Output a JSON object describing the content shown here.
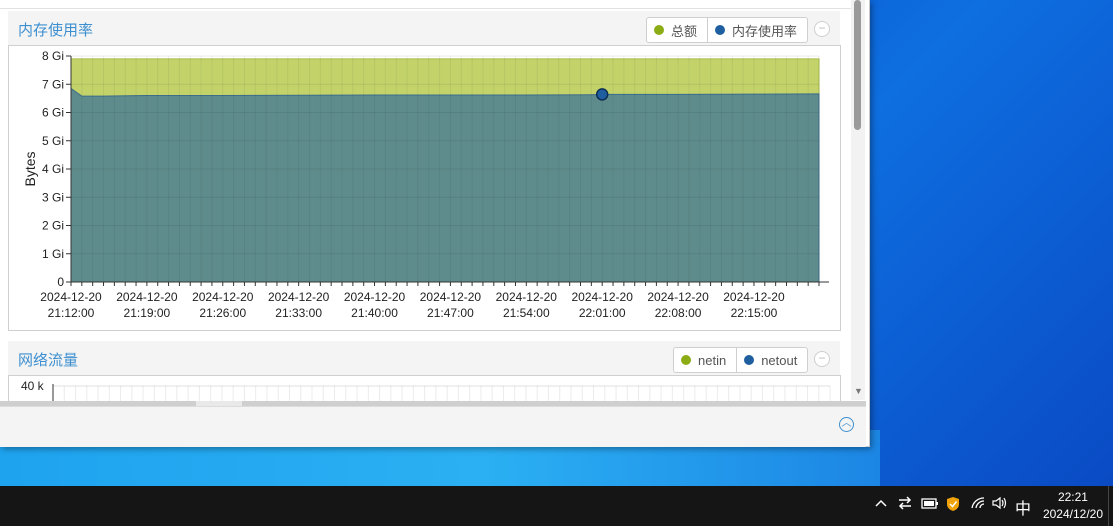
{
  "memory_panel": {
    "title": "内存使用率",
    "legend": [
      {
        "label": "总额",
        "color": "#9bb51e"
      },
      {
        "label": "内存使用率",
        "color": "#1f5fa0"
      }
    ],
    "collapse_symbol": "−"
  },
  "network_panel": {
    "title": "网络流量",
    "legend": [
      {
        "label": "netin",
        "color": "#8cac15"
      },
      {
        "label": "netout",
        "color": "#1f5fa0"
      }
    ],
    "collapse_symbol": "−",
    "y_top_label": "40 k"
  },
  "chart_data": {
    "type": "area",
    "xlabel": "",
    "ylabel": "Bytes",
    "ylim": [
      0,
      8
    ],
    "y_ticks": [
      "0",
      "1 Gi",
      "2 Gi",
      "3 Gi",
      "4 Gi",
      "5 Gi",
      "6 Gi",
      "7 Gi",
      "8 Gi"
    ],
    "x_ticks": [
      [
        "2024-12-20",
        "21:12:00"
      ],
      [
        "2024-12-20",
        "21:19:00"
      ],
      [
        "2024-12-20",
        "21:26:00"
      ],
      [
        "2024-12-20",
        "21:33:00"
      ],
      [
        "2024-12-20",
        "21:40:00"
      ],
      [
        "2024-12-20",
        "21:47:00"
      ],
      [
        "2024-12-20",
        "21:54:00"
      ],
      [
        "2024-12-20",
        "22:01:00"
      ],
      [
        "2024-12-20",
        "22:08:00"
      ],
      [
        "2024-12-20",
        "22:15:00"
      ]
    ],
    "x_minutes_range": [
      "21:12",
      "22:21"
    ],
    "series": [
      {
        "name": "总额",
        "color": "#c3d36a",
        "x": [
          "21:12",
          "22:21"
        ],
        "values": [
          7.9,
          7.9
        ]
      },
      {
        "name": "内存使用率",
        "color": "#5e8c8c",
        "x": [
          "21:12",
          "21:13",
          "21:15",
          "21:19",
          "21:26",
          "21:33",
          "21:40",
          "21:47",
          "21:54",
          "22:00",
          "22:01",
          "22:08",
          "22:15",
          "22:21"
        ],
        "values": [
          6.85,
          6.58,
          6.58,
          6.6,
          6.6,
          6.61,
          6.62,
          6.62,
          6.62,
          6.63,
          6.64,
          6.64,
          6.65,
          6.66
        ]
      }
    ],
    "highlight_point": {
      "x": "22:01",
      "value": 6.64
    },
    "grid": true,
    "legend_position": "top-right"
  },
  "taskbar": {
    "ime": "中",
    "time": "22:21",
    "date": "2024/12/20",
    "icons": [
      "chevron-up-icon",
      "transfer-icon",
      "battery-icon",
      "shield-icon",
      "wifi-icon",
      "volume-icon"
    ]
  }
}
